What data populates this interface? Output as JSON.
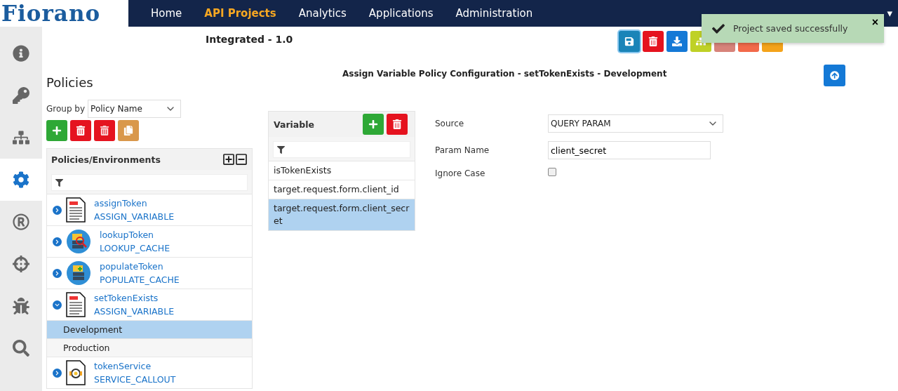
{
  "brand": {
    "logo": "Fiorano"
  },
  "nav": [
    {
      "label": "Home",
      "selected": false
    },
    {
      "label": "API Projects",
      "selected": true
    },
    {
      "label": "Analytics",
      "selected": false
    },
    {
      "label": "Applications",
      "selected": false
    },
    {
      "label": "Administration",
      "selected": false
    }
  ],
  "user": {
    "menu": "▾"
  },
  "toast": {
    "message": "Project saved successfully",
    "close": "×"
  },
  "sidebar": {
    "items": [
      {
        "kind": "info",
        "selected": false
      },
      {
        "kind": "key",
        "selected": false
      },
      {
        "kind": "flow",
        "selected": false
      },
      {
        "kind": "gear",
        "selected": true
      },
      {
        "kind": "registered",
        "selected": false
      },
      {
        "kind": "target",
        "selected": false
      },
      {
        "kind": "bug",
        "selected": false
      },
      {
        "kind": "search",
        "selected": false
      }
    ]
  },
  "project_title": "Integrated - 1.0",
  "toolbar": [
    {
      "kind": "save",
      "color": "#1a84b8"
    },
    {
      "kind": "delete",
      "color": "#e5131f"
    },
    {
      "kind": "download",
      "color": "#1479d6"
    },
    {
      "kind": "hierarchy",
      "color": "#bfd126"
    },
    {
      "kind": "hidden",
      "color": "#d7837a"
    },
    {
      "kind": "hidden",
      "color": "#f26a4a"
    },
    {
      "kind": "hidden",
      "color": "#f4a31a"
    }
  ],
  "heading": "Policies",
  "group_by": {
    "label": "Group by",
    "value": "Policy Name"
  },
  "policy_actions": [
    {
      "kind": "add",
      "color": "#2ea836"
    },
    {
      "kind": "delete",
      "color": "#e5131f"
    },
    {
      "kind": "delete-env",
      "color": "#e5131f"
    },
    {
      "kind": "copy",
      "color": "#d9984b"
    }
  ],
  "tree": {
    "title": "Policies/Environments",
    "items": [
      {
        "name": "assignToken",
        "type": "ASSIGN_VARIABLE",
        "kind": "variable",
        "expanded": false
      },
      {
        "name": "lookupToken",
        "type": "LOOKUP_CACHE",
        "kind": "lookup",
        "expanded": false
      },
      {
        "name": "populateToken",
        "type": "POPULATE_CACHE",
        "kind": "populate",
        "expanded": false
      },
      {
        "name": "setTokenExists",
        "type": "ASSIGN_VARIABLE",
        "kind": "variable",
        "expanded": true,
        "children": [
          {
            "label": "Development",
            "selected": true
          },
          {
            "label": "Production",
            "selected": false
          }
        ]
      },
      {
        "name": "tokenService",
        "type": "SERVICE_CALLOUT",
        "kind": "service",
        "expanded": false
      }
    ]
  },
  "config_title": "Assign Variable Policy Configuration - setTokenExists - Development",
  "variables": {
    "title": "Variable",
    "items": [
      {
        "label": "isTokenExists",
        "selected": false
      },
      {
        "label": "target.request.form.client_id",
        "selected": false
      },
      {
        "label": "target.request.form.client_secret",
        "selected": true
      }
    ]
  },
  "form": {
    "source": {
      "label": "Source",
      "value": "QUERY PARAM"
    },
    "param_name": {
      "label": "Param Name",
      "value": "client_secret"
    },
    "ignore_case": {
      "label": "Ignore Case",
      "checked": false
    }
  }
}
